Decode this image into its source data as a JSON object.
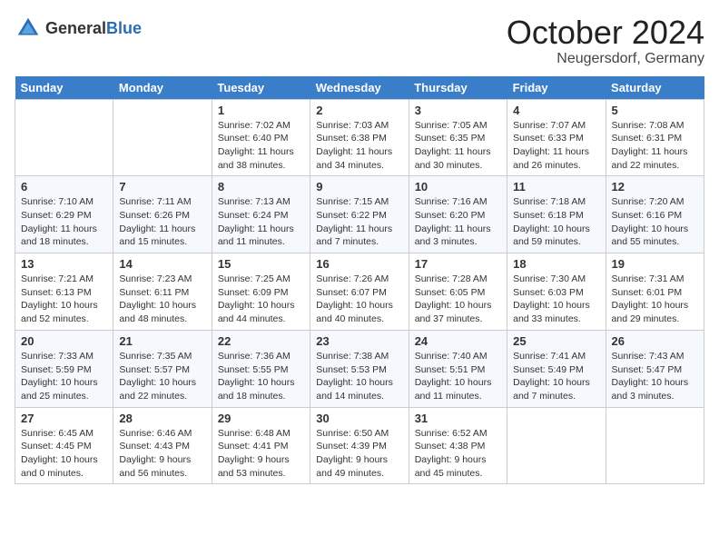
{
  "header": {
    "logo_general": "General",
    "logo_blue": "Blue",
    "month": "October 2024",
    "location": "Neugersdorf, Germany"
  },
  "weekdays": [
    "Sunday",
    "Monday",
    "Tuesday",
    "Wednesday",
    "Thursday",
    "Friday",
    "Saturday"
  ],
  "weeks": [
    [
      {
        "day": "",
        "sunrise": "",
        "sunset": "",
        "daylight": ""
      },
      {
        "day": "",
        "sunrise": "",
        "sunset": "",
        "daylight": ""
      },
      {
        "day": "1",
        "sunrise": "Sunrise: 7:02 AM",
        "sunset": "Sunset: 6:40 PM",
        "daylight": "Daylight: 11 hours and 38 minutes."
      },
      {
        "day": "2",
        "sunrise": "Sunrise: 7:03 AM",
        "sunset": "Sunset: 6:38 PM",
        "daylight": "Daylight: 11 hours and 34 minutes."
      },
      {
        "day": "3",
        "sunrise": "Sunrise: 7:05 AM",
        "sunset": "Sunset: 6:35 PM",
        "daylight": "Daylight: 11 hours and 30 minutes."
      },
      {
        "day": "4",
        "sunrise": "Sunrise: 7:07 AM",
        "sunset": "Sunset: 6:33 PM",
        "daylight": "Daylight: 11 hours and 26 minutes."
      },
      {
        "day": "5",
        "sunrise": "Sunrise: 7:08 AM",
        "sunset": "Sunset: 6:31 PM",
        "daylight": "Daylight: 11 hours and 22 minutes."
      }
    ],
    [
      {
        "day": "6",
        "sunrise": "Sunrise: 7:10 AM",
        "sunset": "Sunset: 6:29 PM",
        "daylight": "Daylight: 11 hours and 18 minutes."
      },
      {
        "day": "7",
        "sunrise": "Sunrise: 7:11 AM",
        "sunset": "Sunset: 6:26 PM",
        "daylight": "Daylight: 11 hours and 15 minutes."
      },
      {
        "day": "8",
        "sunrise": "Sunrise: 7:13 AM",
        "sunset": "Sunset: 6:24 PM",
        "daylight": "Daylight: 11 hours and 11 minutes."
      },
      {
        "day": "9",
        "sunrise": "Sunrise: 7:15 AM",
        "sunset": "Sunset: 6:22 PM",
        "daylight": "Daylight: 11 hours and 7 minutes."
      },
      {
        "day": "10",
        "sunrise": "Sunrise: 7:16 AM",
        "sunset": "Sunset: 6:20 PM",
        "daylight": "Daylight: 11 hours and 3 minutes."
      },
      {
        "day": "11",
        "sunrise": "Sunrise: 7:18 AM",
        "sunset": "Sunset: 6:18 PM",
        "daylight": "Daylight: 10 hours and 59 minutes."
      },
      {
        "day": "12",
        "sunrise": "Sunrise: 7:20 AM",
        "sunset": "Sunset: 6:16 PM",
        "daylight": "Daylight: 10 hours and 55 minutes."
      }
    ],
    [
      {
        "day": "13",
        "sunrise": "Sunrise: 7:21 AM",
        "sunset": "Sunset: 6:13 PM",
        "daylight": "Daylight: 10 hours and 52 minutes."
      },
      {
        "day": "14",
        "sunrise": "Sunrise: 7:23 AM",
        "sunset": "Sunset: 6:11 PM",
        "daylight": "Daylight: 10 hours and 48 minutes."
      },
      {
        "day": "15",
        "sunrise": "Sunrise: 7:25 AM",
        "sunset": "Sunset: 6:09 PM",
        "daylight": "Daylight: 10 hours and 44 minutes."
      },
      {
        "day": "16",
        "sunrise": "Sunrise: 7:26 AM",
        "sunset": "Sunset: 6:07 PM",
        "daylight": "Daylight: 10 hours and 40 minutes."
      },
      {
        "day": "17",
        "sunrise": "Sunrise: 7:28 AM",
        "sunset": "Sunset: 6:05 PM",
        "daylight": "Daylight: 10 hours and 37 minutes."
      },
      {
        "day": "18",
        "sunrise": "Sunrise: 7:30 AM",
        "sunset": "Sunset: 6:03 PM",
        "daylight": "Daylight: 10 hours and 33 minutes."
      },
      {
        "day": "19",
        "sunrise": "Sunrise: 7:31 AM",
        "sunset": "Sunset: 6:01 PM",
        "daylight": "Daylight: 10 hours and 29 minutes."
      }
    ],
    [
      {
        "day": "20",
        "sunrise": "Sunrise: 7:33 AM",
        "sunset": "Sunset: 5:59 PM",
        "daylight": "Daylight: 10 hours and 25 minutes."
      },
      {
        "day": "21",
        "sunrise": "Sunrise: 7:35 AM",
        "sunset": "Sunset: 5:57 PM",
        "daylight": "Daylight: 10 hours and 22 minutes."
      },
      {
        "day": "22",
        "sunrise": "Sunrise: 7:36 AM",
        "sunset": "Sunset: 5:55 PM",
        "daylight": "Daylight: 10 hours and 18 minutes."
      },
      {
        "day": "23",
        "sunrise": "Sunrise: 7:38 AM",
        "sunset": "Sunset: 5:53 PM",
        "daylight": "Daylight: 10 hours and 14 minutes."
      },
      {
        "day": "24",
        "sunrise": "Sunrise: 7:40 AM",
        "sunset": "Sunset: 5:51 PM",
        "daylight": "Daylight: 10 hours and 11 minutes."
      },
      {
        "day": "25",
        "sunrise": "Sunrise: 7:41 AM",
        "sunset": "Sunset: 5:49 PM",
        "daylight": "Daylight: 10 hours and 7 minutes."
      },
      {
        "day": "26",
        "sunrise": "Sunrise: 7:43 AM",
        "sunset": "Sunset: 5:47 PM",
        "daylight": "Daylight: 10 hours and 3 minutes."
      }
    ],
    [
      {
        "day": "27",
        "sunrise": "Sunrise: 6:45 AM",
        "sunset": "Sunset: 4:45 PM",
        "daylight": "Daylight: 10 hours and 0 minutes."
      },
      {
        "day": "28",
        "sunrise": "Sunrise: 6:46 AM",
        "sunset": "Sunset: 4:43 PM",
        "daylight": "Daylight: 9 hours and 56 minutes."
      },
      {
        "day": "29",
        "sunrise": "Sunrise: 6:48 AM",
        "sunset": "Sunset: 4:41 PM",
        "daylight": "Daylight: 9 hours and 53 minutes."
      },
      {
        "day": "30",
        "sunrise": "Sunrise: 6:50 AM",
        "sunset": "Sunset: 4:39 PM",
        "daylight": "Daylight: 9 hours and 49 minutes."
      },
      {
        "day": "31",
        "sunrise": "Sunrise: 6:52 AM",
        "sunset": "Sunset: 4:38 PM",
        "daylight": "Daylight: 9 hours and 45 minutes."
      },
      {
        "day": "",
        "sunrise": "",
        "sunset": "",
        "daylight": ""
      },
      {
        "day": "",
        "sunrise": "",
        "sunset": "",
        "daylight": ""
      }
    ]
  ]
}
